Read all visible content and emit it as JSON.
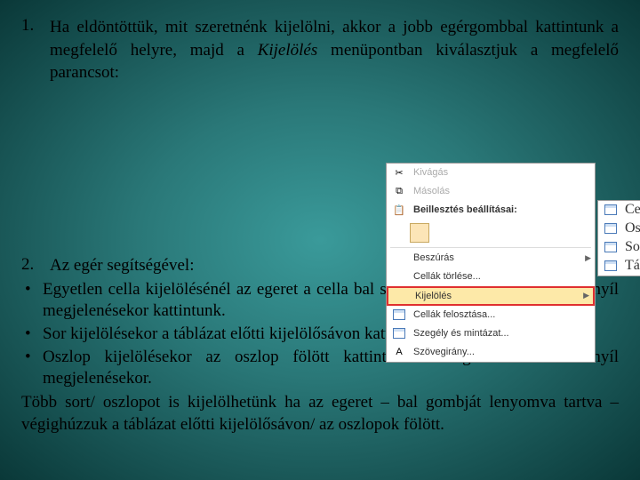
{
  "item1": {
    "num": "1.",
    "text_before": "Ha eldöntöttük, mit szeretnénk kijelölni, akkor a jobb egérgombbal kattintunk a megfelelő helyre, majd a ",
    "italic": "Kijelölés",
    "text_after": " menüpontban kiválasztjuk a megfelelő parancsot:"
  },
  "menu": {
    "cut": "Kivágás",
    "copy": "Másolás",
    "paste_header": "Beillesztés beállításai:",
    "insert": "Beszúrás",
    "delete_cells": "Cellák törlése...",
    "select": "Kijelölés",
    "split_cells": "Cellák felosztása...",
    "borders": "Szegély és mintázat...",
    "text_dir": "Szövegirány...",
    "sub": {
      "cell": "Cella",
      "column": "Oszlop",
      "row": "Sor",
      "table": "Táblázat"
    }
  },
  "item2": {
    "num": "2.",
    "intro": "Az egér segítségével:",
    "bullets": [
      "Egyetlen cella kijelölésénél az egeret  a cella bal szélére mozgatjuk, és a fekete nyíl megjelenésekor kattintunk.",
      "Sor kijelölésekor a táblázat előtti kijelölősávon kattintunk az egérrel.",
      "Oszlop kijelölésekor az oszlop fölött kattintunk az egérrel a fekete nyíl megjelenésekor."
    ],
    "closing": "Több sort/ oszlopot is kijelölhetünk ha az egeret – bal gombját lenyomva tartva – végighúzzuk a táblázat előtti kijelölősávon/ az oszlopok fölött."
  }
}
